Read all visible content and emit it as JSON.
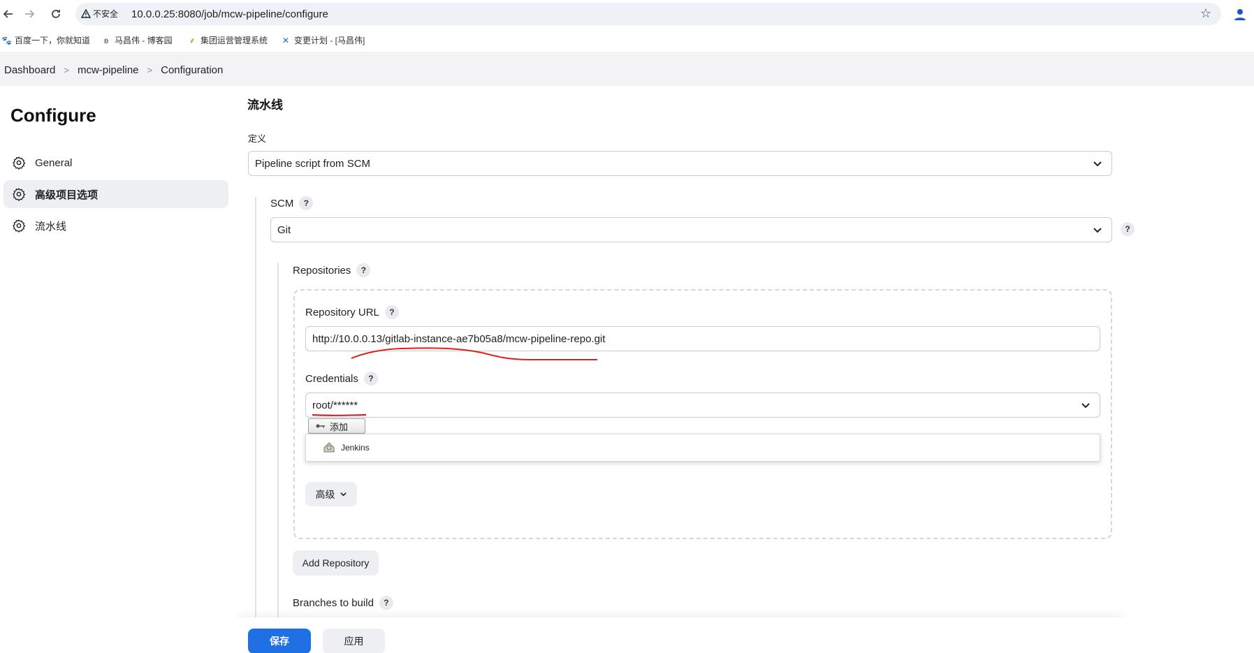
{
  "browser": {
    "security_label": "不安全",
    "url": "10.0.0.25:8080/job/mcw-pipeline/configure",
    "bookmarks": [
      {
        "label": "百度一下，你就知道",
        "icon": "baidu-icon"
      },
      {
        "label": "马昌伟 - 博客园",
        "icon": "cnblogs-icon"
      },
      {
        "label": "集团运营管理系统",
        "icon": "ops-icon"
      },
      {
        "label": "变更计划 - [马昌伟]",
        "icon": "confluence-icon"
      }
    ]
  },
  "breadcrumb": [
    "Dashboard",
    "mcw-pipeline",
    "Configuration"
  ],
  "sidebar": {
    "title": "Configure",
    "items": [
      {
        "label": "General",
        "icon": "gear-icon"
      },
      {
        "label": "高级项目选项",
        "icon": "gear-icon",
        "active": true
      },
      {
        "label": "流水线",
        "icon": "gear-icon"
      }
    ]
  },
  "main": {
    "section_title": "流水线",
    "definition_label": "定义",
    "definition_value": "Pipeline script from SCM",
    "scm_label": "SCM",
    "scm_value": "Git",
    "repositories_label": "Repositories",
    "repo_url_label": "Repository URL",
    "repo_url_value": "http://10.0.0.13/gitlab-instance-ae7b05a8/mcw-pipeline-repo.git",
    "credentials_label": "Credentials",
    "credentials_value": "root/******",
    "add_button": "添加",
    "add_dropdown_item": "Jenkins",
    "advanced_button": "高级",
    "add_repository_button": "Add Repository",
    "branches_label": "Branches to build",
    "help_glyph": "?"
  },
  "footer": {
    "save": "保存",
    "apply": "应用"
  },
  "colors": {
    "primary": "#1f6fe5",
    "annotation": "#e02020"
  }
}
